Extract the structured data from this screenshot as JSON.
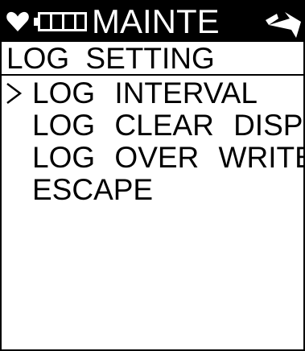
{
  "header": {
    "title": "MAINTE",
    "icons": [
      "heart-icon",
      "battery-icon",
      "signal-arrow-icon"
    ]
  },
  "screen": {
    "title": "LOG SETTING"
  },
  "menu": {
    "items": [
      {
        "label": "LOG INTERVAL",
        "selected": true
      },
      {
        "label": "LOG CLEAR DISP",
        "selected": false
      },
      {
        "label": "LOG OVER WRITE",
        "selected": false
      },
      {
        "label": "ESCAPE",
        "selected": false
      }
    ]
  },
  "colors": {
    "header_background": "#000000",
    "header_text": "#ffffff",
    "screen_background": "#ffffff",
    "text": "#000000"
  }
}
